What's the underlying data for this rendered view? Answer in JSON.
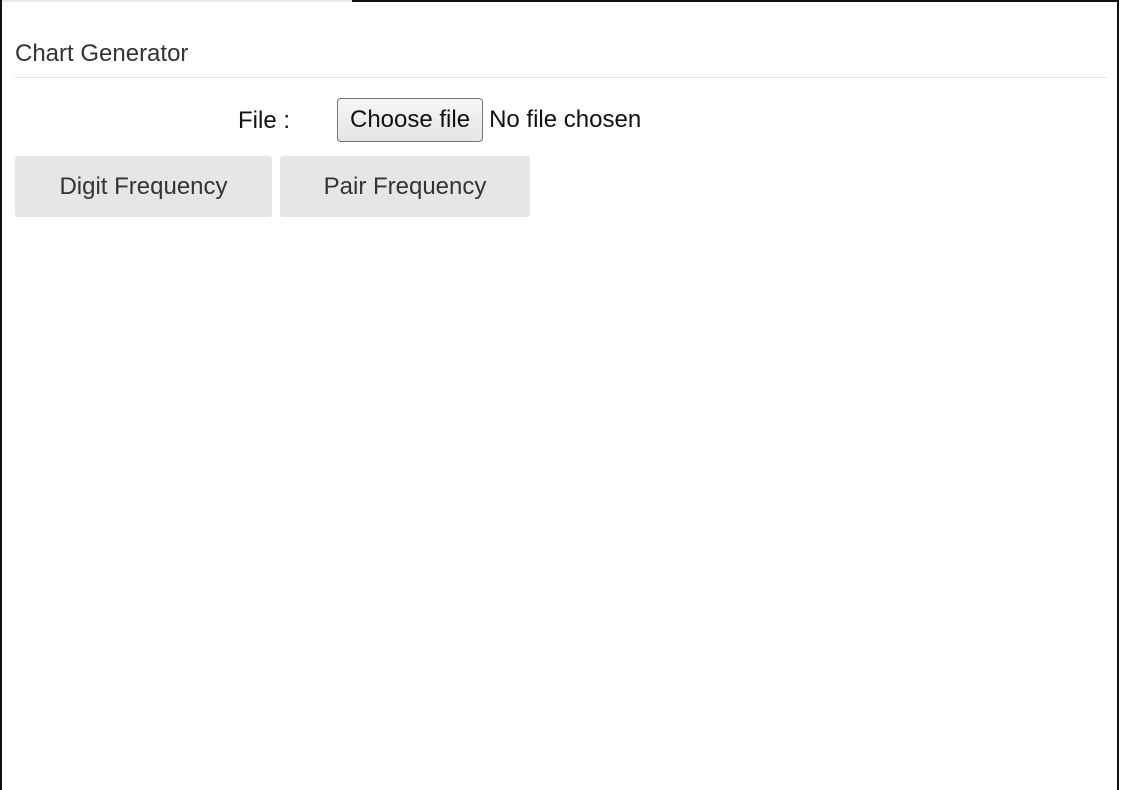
{
  "header": {
    "title": "Chart Generator"
  },
  "file_input": {
    "label": "File :",
    "button_label": "Choose file",
    "status": "No file chosen"
  },
  "actions": {
    "digit_frequency_label": "Digit Frequency",
    "pair_frequency_label": "Pair Frequency"
  },
  "colors": {
    "background": "#ffffff",
    "button_background": "#e6e6e6",
    "text": "#333333",
    "border": "#111111"
  }
}
